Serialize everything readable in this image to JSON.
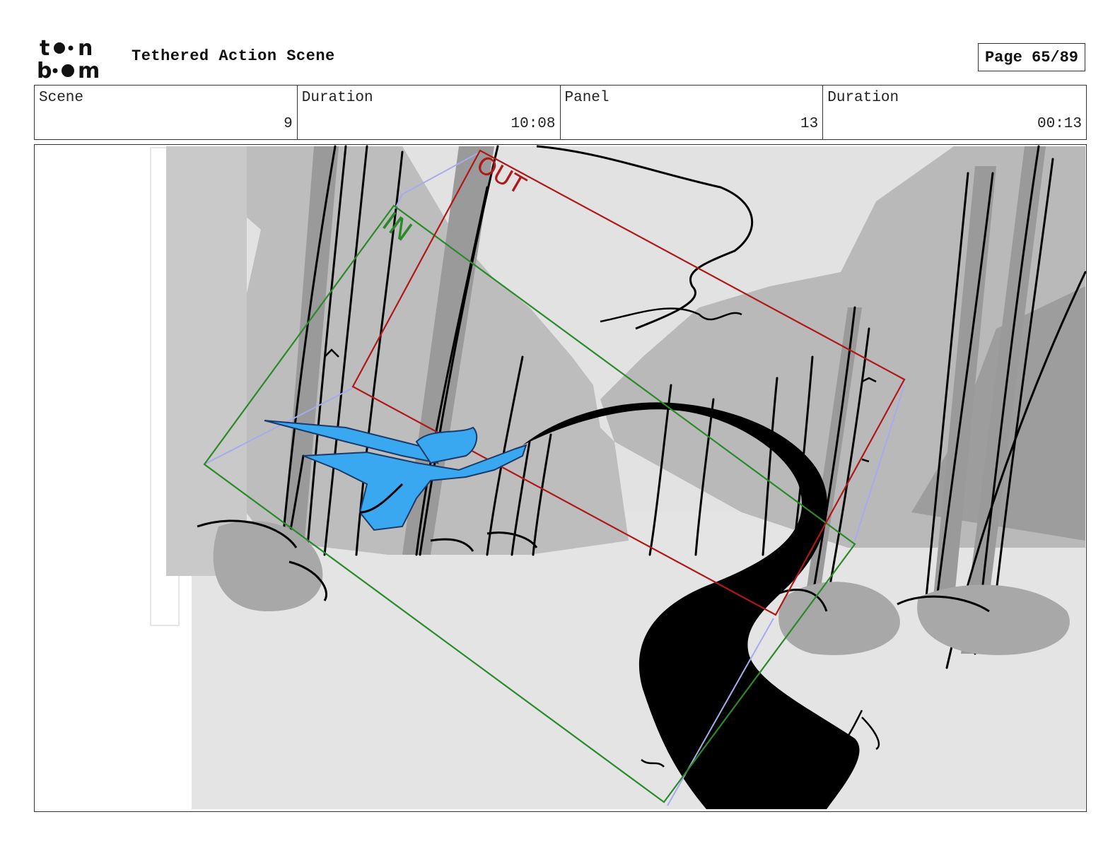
{
  "header": {
    "logo_text": "toon boom",
    "project_title": "Tethered Action Scene",
    "page_label": "Page",
    "page_number": "65/89"
  },
  "info": {
    "scene_label": "Scene",
    "scene_value": "9",
    "scene_duration_label": "Duration",
    "scene_duration_value": "10:08",
    "panel_label": "Panel",
    "panel_value": "13",
    "panel_duration_label": "Duration",
    "panel_duration_value": "00:13"
  },
  "panel": {
    "camera_in_label": "IN",
    "camera_out_label": "OUT",
    "colors": {
      "camera_in": "#2a8a2a",
      "camera_out": "#b01818",
      "character": "#3aa8f0",
      "river": "#000000",
      "background_light": "#e4e4e4",
      "background_mid": "#bdbdbd",
      "background_dark": "#9e9e9e"
    }
  }
}
